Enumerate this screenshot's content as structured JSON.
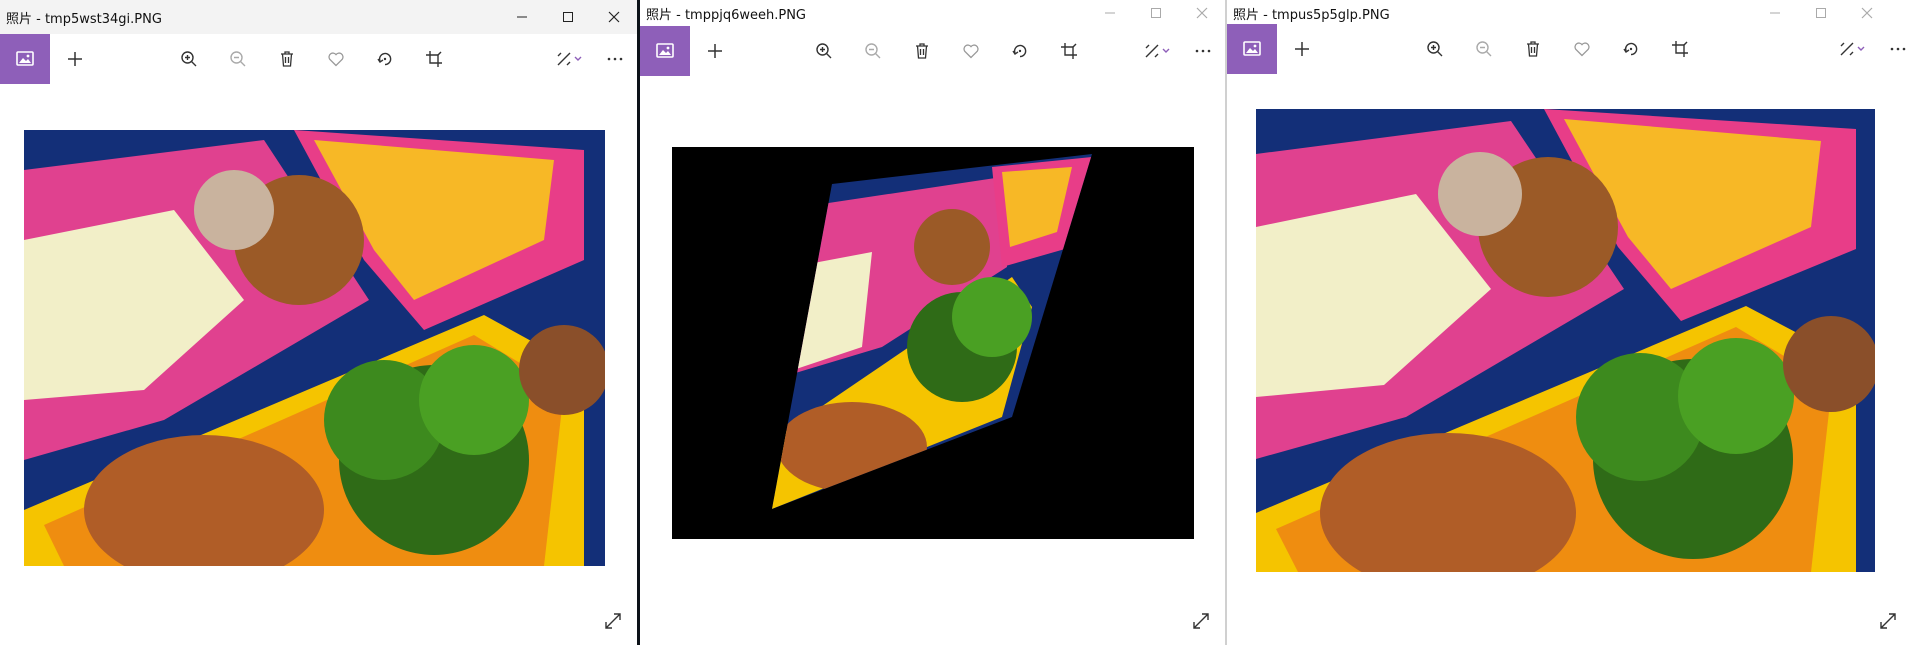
{
  "windows": [
    {
      "title": "照片 - tmp5wst34gi.PNG"
    },
    {
      "title": "照片 - tmppjq6weeh.PNG"
    },
    {
      "title": "照片 - tmpus5p5glp.PNG"
    }
  ],
  "icons": [
    "view-photo-icon",
    "add-icon",
    "zoom-in-icon",
    "zoom-out-icon",
    "delete-icon",
    "favorite-icon",
    "rotate-icon",
    "crop-icon",
    "edit-icon",
    "chevron-down-icon",
    "more-icon",
    "minimize-icon",
    "maximize-icon",
    "close-icon",
    "expand-icon"
  ],
  "colors": {
    "accent": "#8e5fb9",
    "titlebar": "#f3f3f3"
  }
}
